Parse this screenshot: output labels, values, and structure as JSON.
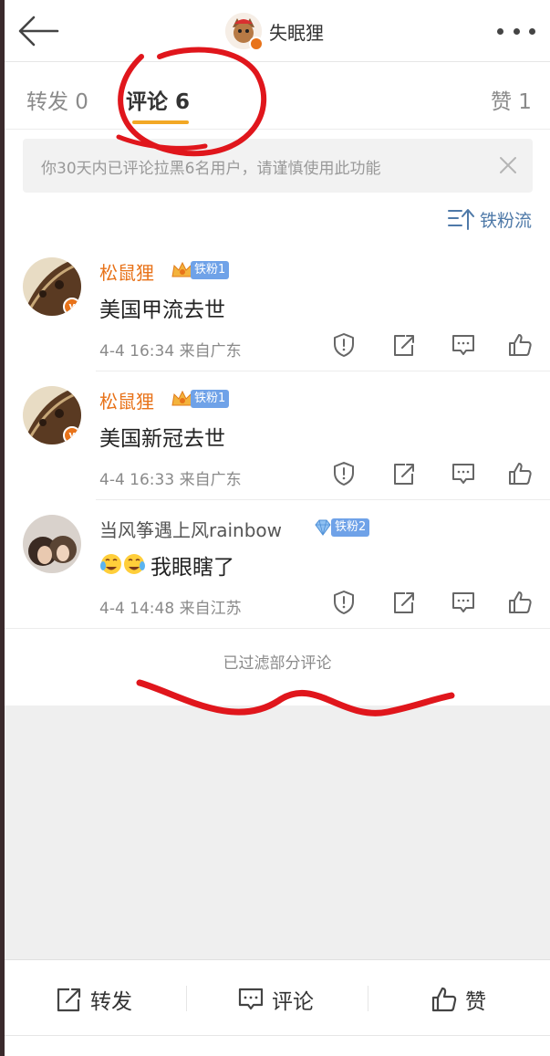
{
  "header": {
    "title": "失眠狸",
    "back_icon": "back-arrow-icon",
    "more_icon": "more-dots-icon"
  },
  "tabs": [
    {
      "label": "转发 0"
    },
    {
      "label": "评论 6"
    },
    {
      "label": "赞 1"
    }
  ],
  "notice": {
    "text": "你30天内已评论拉黑6名用户，请谨慎使用此功能"
  },
  "sort": {
    "label": "铁粉流"
  },
  "comments": [
    {
      "name": "松鼠狸",
      "badge": "铁粉1",
      "text": "美国甲流去世",
      "meta": "4-4 16:34  来自广东"
    },
    {
      "name": "松鼠狸",
      "badge": "铁粉1",
      "text": "美国新冠去世",
      "meta": "4-4 16:33  来自广东"
    },
    {
      "name": "当风筝遇上风rainbow",
      "badge": "铁粉2",
      "text": "我眼瞎了",
      "meta": "4-4 14:48  来自江苏"
    }
  ],
  "filtered": "已过滤部分评论",
  "bottom": {
    "repost": "转发",
    "comment": "评论",
    "like": "赞"
  },
  "colors": {
    "accent": "#f2a825",
    "name_orange": "#e8731a",
    "link_blue": "#4e79a8",
    "badge_blue": "#6fa2e8",
    "annotation_red": "#e0161c"
  }
}
